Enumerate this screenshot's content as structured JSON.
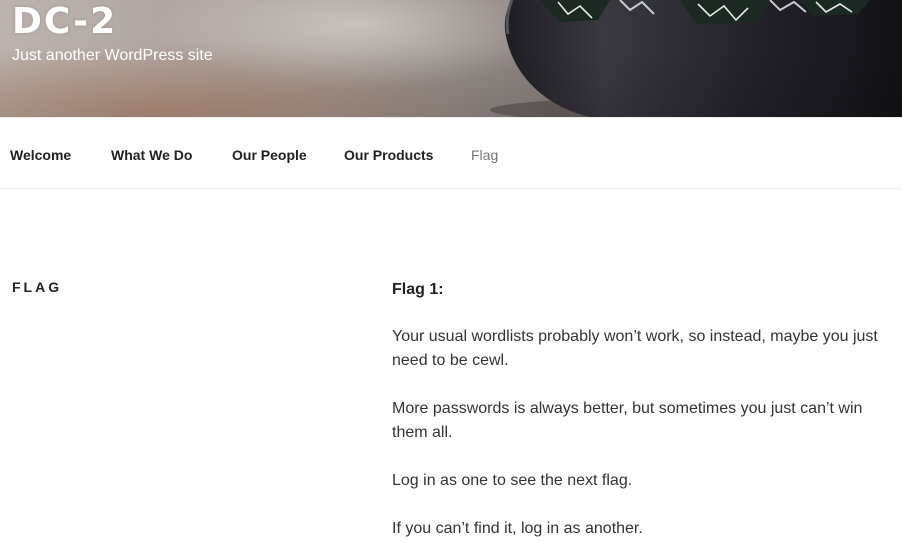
{
  "header": {
    "site_title": "DC-2",
    "site_description": "Just another WordPress site"
  },
  "nav": {
    "items": [
      {
        "label": "Welcome",
        "current": false
      },
      {
        "label": "What We Do",
        "current": false
      },
      {
        "label": "Our People",
        "current": false
      },
      {
        "label": "Our Products",
        "current": false
      },
      {
        "label": "Flag",
        "current": true
      }
    ]
  },
  "page": {
    "title": "FLAG",
    "heading": "Flag 1:",
    "paragraphs": [
      "Your usual wordlists probably won’t work, so instead, maybe you just need to be cewl.",
      "More passwords is always better, but sometimes you just can’t win them all.",
      "Log in as one to see the next flag.",
      "If you can’t find it, log in as another."
    ]
  },
  "colors": {
    "nav_text": "#222222",
    "nav_current": "#767676",
    "body_text": "#333333",
    "header_text": "#ffffff"
  }
}
